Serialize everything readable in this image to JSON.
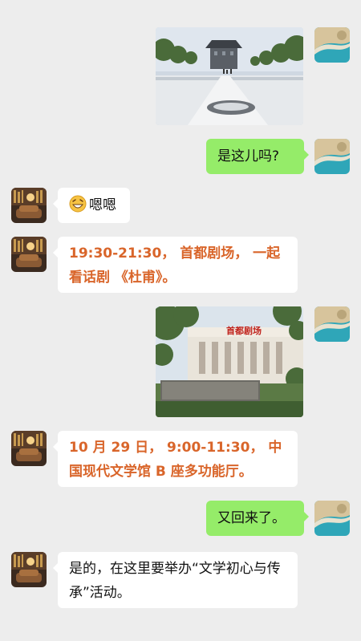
{
  "colors": {
    "background": "#ededed",
    "sent_bubble": "#95ec69",
    "received_bubble": "#ffffff",
    "highlight_text": "#d9652a"
  },
  "messages": [
    {
      "side": "right",
      "type": "image",
      "subject": "paved avenue leading to an old city gate tower"
    },
    {
      "side": "right",
      "type": "text",
      "text": "是这儿吗?"
    },
    {
      "side": "left",
      "type": "text",
      "emoji": "grinning-face-emoji",
      "text": "嗯嗯"
    },
    {
      "side": "left",
      "type": "text",
      "text": "19:30-21:30， 首都剧场， 一起看话剧 《杜甫》。"
    },
    {
      "side": "right",
      "type": "image",
      "subject": "theater building with red sign and stone inscription",
      "sign_text": "首都剧场"
    },
    {
      "side": "left",
      "type": "text",
      "text": "10 月 29 日， 9:00-11:30， 中国现代文学馆 B 座多功能厅。"
    },
    {
      "side": "right",
      "type": "text",
      "text": "又回来了。"
    },
    {
      "side": "left",
      "type": "text",
      "text": "是的，在这里要举办“文学初心与传承”活动。"
    }
  ],
  "avatars": {
    "self": "ocean-coast-avatar",
    "other": "reading-room-avatar"
  }
}
